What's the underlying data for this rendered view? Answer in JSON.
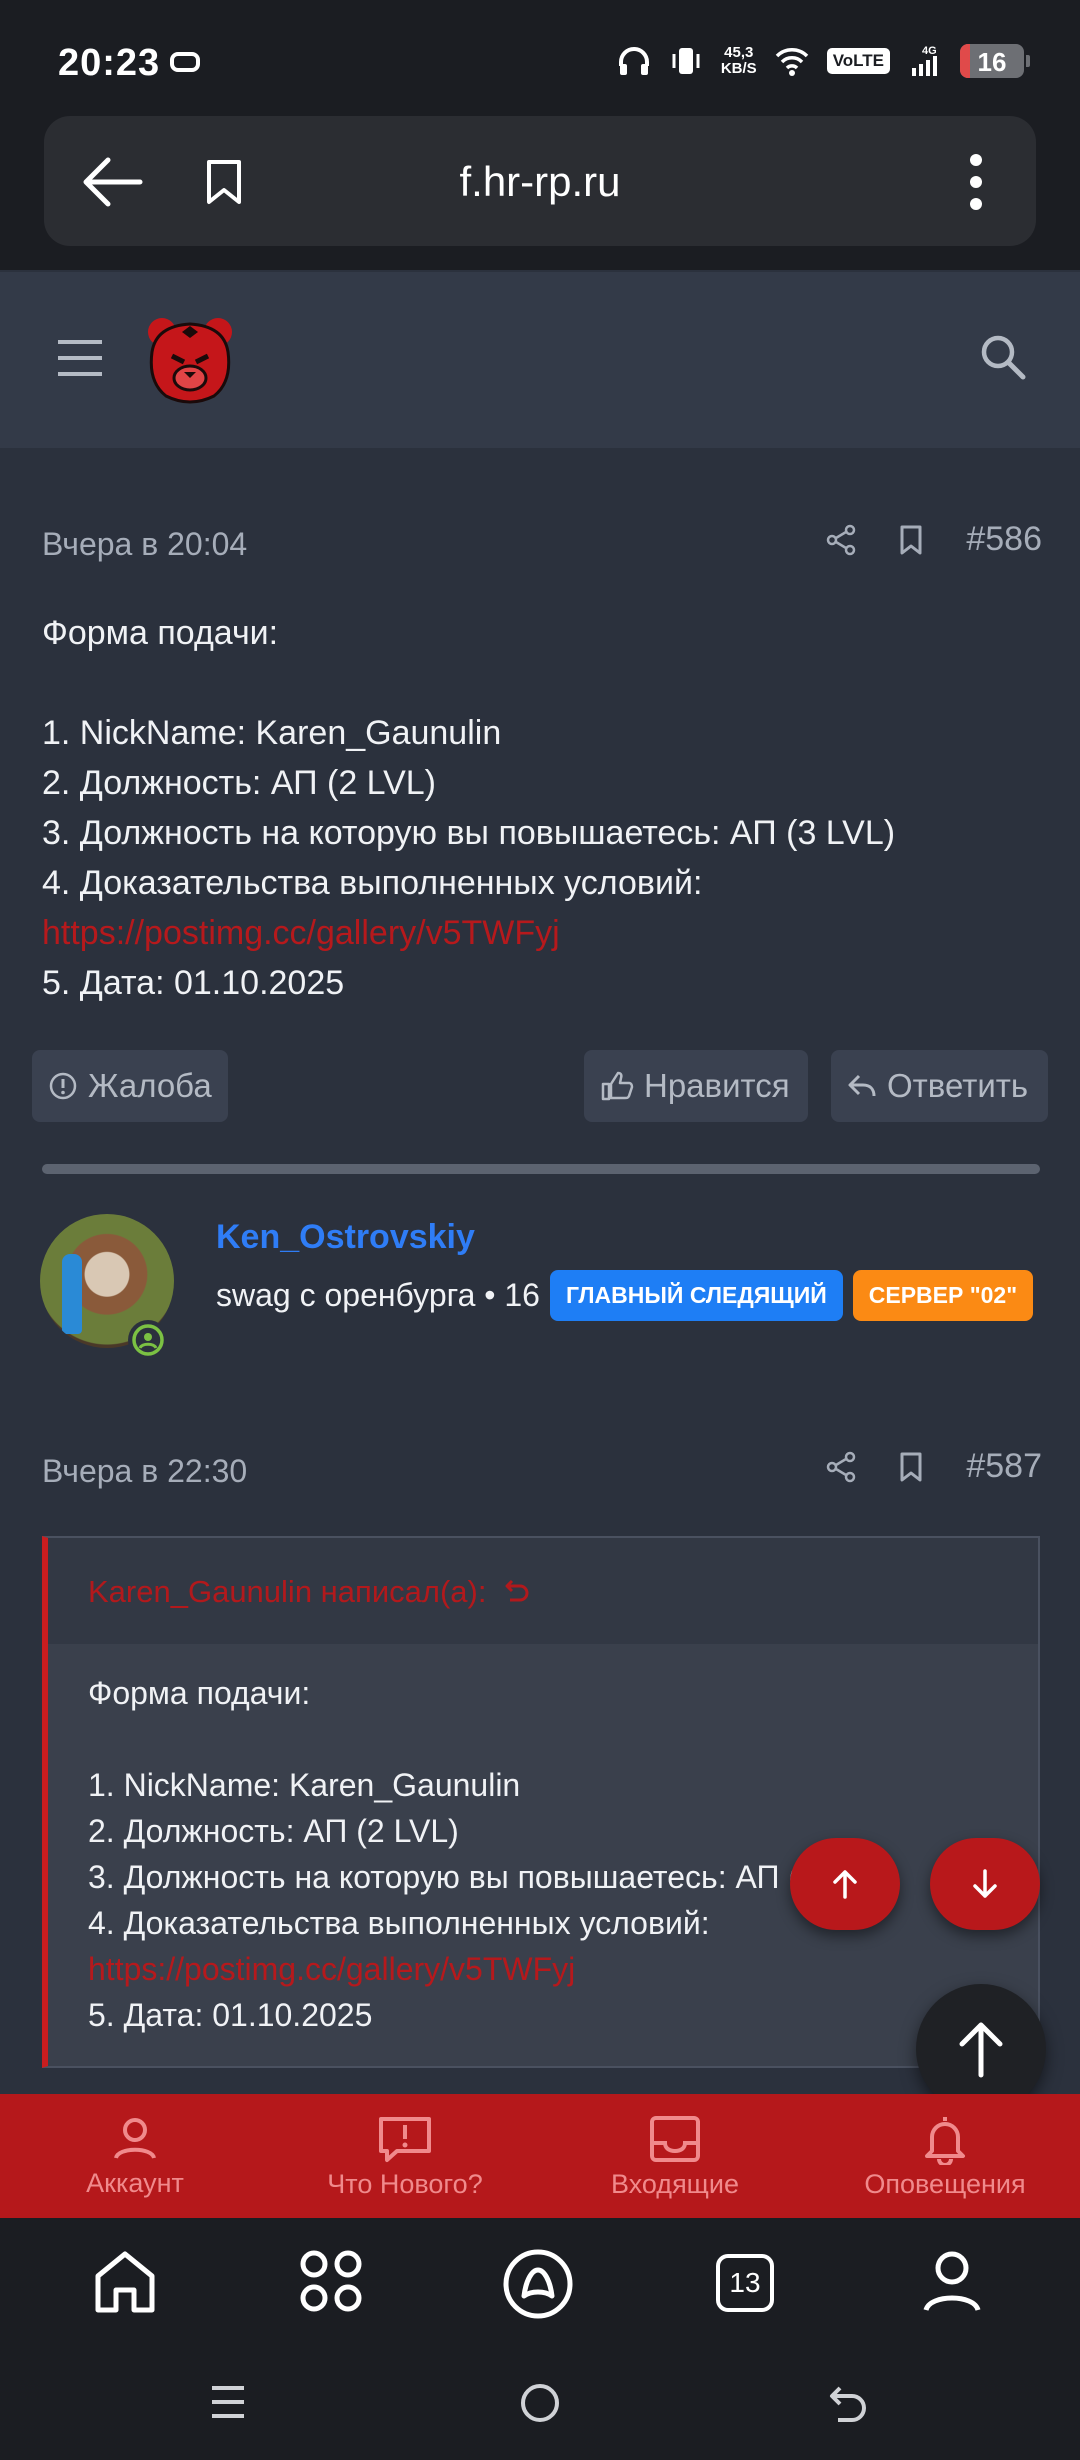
{
  "status_bar": {
    "time": "20:23",
    "speed_value": "45,3",
    "speed_unit": "KB/S",
    "volte": "VoLTE",
    "network": "4G",
    "battery": "16"
  },
  "browser": {
    "url": "f.hr-rp.ru",
    "tabs_count": "13"
  },
  "posts": [
    {
      "date": "Вчера в 20:04",
      "number": "#586",
      "body": {
        "title": "Форма подачи:",
        "item1": "1. NickName: Karen_Gaunulin",
        "item2": "2. Должность: АП (2 LVL)",
        "item3": "3. Должность на которую вы повышаетесь: АП (3 LVL)",
        "item4": "4. Доказательства выполненных условий:",
        "link": "https://postimg.cc/gallery/v5TWFyj",
        "item5": "5. Дата: 01.10.2025"
      },
      "actions": {
        "report": "Жалоба",
        "like": "Нравится",
        "reply": "Ответить"
      }
    },
    {
      "date": "Вчера в 22:30",
      "number": "#587",
      "quote": {
        "author": "Karen_Gaunulin написал(а):",
        "title": "Форма подачи:",
        "item1": "1. NickName: Karen_Gaunulin",
        "item2": "2. Должность: АП (2 LVL)",
        "item3": "3. Должность на которую вы повышаетесь: АП (3 LVL)",
        "item4": "4. Доказательства выполненных условий:",
        "link": "https://postimg.cc/gallery/v5TWFyj",
        "item5": "5. Дата: 01.10.2025"
      }
    }
  ],
  "author": {
    "name": "Ken_Ostrovskiy",
    "title": "swag с оренбурга • 16",
    "badge1": "ГЛАВНЫЙ СЛЕДЯЩИЙ",
    "badge2": "СЕРВЕР \"02\""
  },
  "forum_nav": {
    "account": "Аккаунт",
    "whats_new": "Что Нового?",
    "inbox": "Входящие",
    "alerts": "Оповещения"
  },
  "colors": {
    "accent": "#b5181b",
    "page_bg": "#2b313d",
    "header_bg": "#333a48",
    "username": "#2f7df6",
    "badge_blue": "#1e7ef5",
    "badge_orange": "#fb8a14"
  }
}
